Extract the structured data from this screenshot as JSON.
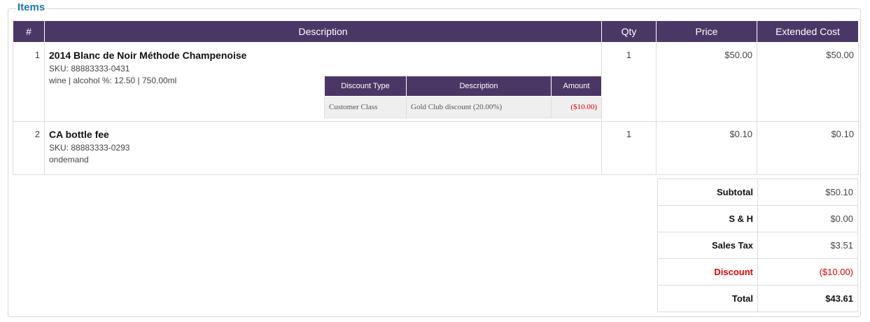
{
  "section": {
    "legend": "Items"
  },
  "items_table": {
    "headers": [
      "#",
      "Description",
      "Qty",
      "Price",
      "Extended Cost"
    ],
    "rows": [
      {
        "num": "1",
        "name": "2014 Blanc de Noir Méthode Champenoise",
        "sku": "SKU: 88883333-0431",
        "details": "wine | alcohol %: 12.50 | 750.00ml",
        "qty": "1",
        "price": "$50.00",
        "extended": "$50.00",
        "discounts": {
          "headers": [
            "Discount Type",
            "Description",
            "Amount"
          ],
          "rows": [
            {
              "type": "Customer Class",
              "description": "Gold Club discount (20.00%)",
              "amount": "($10.00)"
            }
          ]
        }
      },
      {
        "num": "2",
        "name": "CA bottle fee",
        "sku": "SKU: 88883333-0293",
        "details": "ondemand",
        "qty": "1",
        "price": "$0.10",
        "extended": "$0.10"
      }
    ]
  },
  "totals": {
    "subtotal_label": "Subtotal",
    "subtotal": "$50.10",
    "sh_label": "S & H",
    "sh": "$0.00",
    "tax_label": "Sales Tax",
    "tax": "$3.51",
    "discount_label": "Discount",
    "discount": "($10.00)",
    "total_label": "Total",
    "total": "$43.61"
  },
  "colors": {
    "header_bg": "#4b3766",
    "legend": "#1b76b0",
    "discount": "#e00000"
  }
}
